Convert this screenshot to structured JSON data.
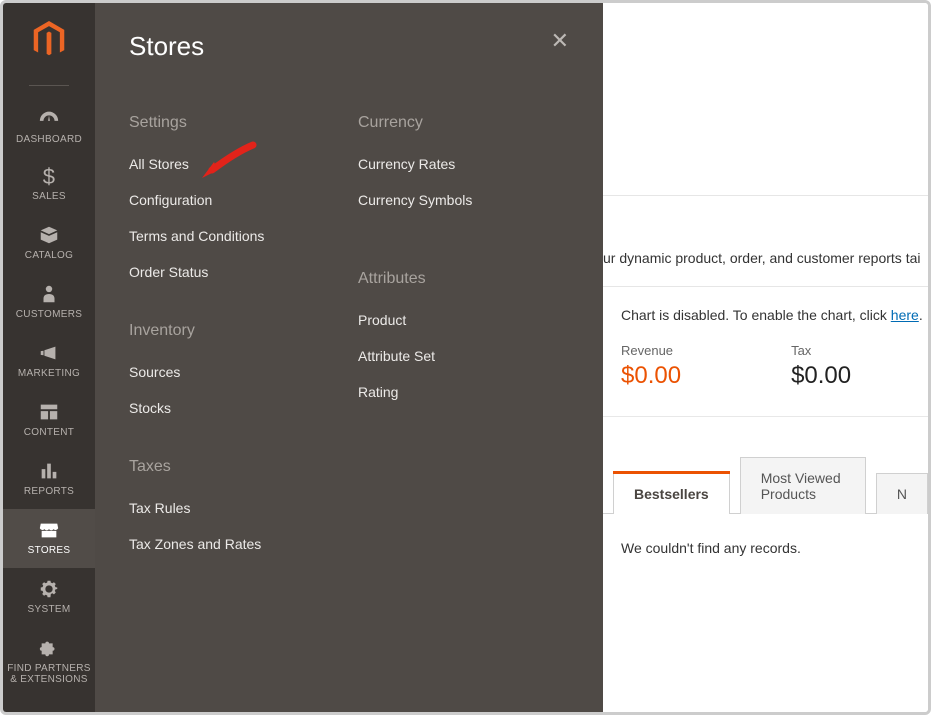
{
  "nav": {
    "items": [
      {
        "id": "dashboard",
        "label": "DASHBOARD"
      },
      {
        "id": "sales",
        "label": "SALES"
      },
      {
        "id": "catalog",
        "label": "CATALOG"
      },
      {
        "id": "customers",
        "label": "CUSTOMERS"
      },
      {
        "id": "marketing",
        "label": "MARKETING"
      },
      {
        "id": "content",
        "label": "CONTENT"
      },
      {
        "id": "reports",
        "label": "REPORTS"
      },
      {
        "id": "stores",
        "label": "STORES"
      },
      {
        "id": "system",
        "label": "SYSTEM"
      },
      {
        "id": "partners",
        "label": "FIND PARTNERS & EXTENSIONS"
      }
    ]
  },
  "flyout": {
    "title": "Stores",
    "column1": {
      "settings": {
        "title": "Settings",
        "items": [
          "All Stores",
          "Configuration",
          "Terms and Conditions",
          "Order Status"
        ]
      },
      "inventory": {
        "title": "Inventory",
        "items": [
          "Sources",
          "Stocks"
        ]
      },
      "taxes": {
        "title": "Taxes",
        "items": [
          "Tax Rules",
          "Tax Zones and Rates"
        ]
      }
    },
    "column2": {
      "currency": {
        "title": "Currency",
        "items": [
          "Currency Rates",
          "Currency Symbols"
        ]
      },
      "attributes": {
        "title": "Attributes",
        "items": [
          "Product",
          "Attribute Set",
          "Rating"
        ]
      }
    }
  },
  "main": {
    "bi_notice_fragment": "ur dynamic product, order, and customer reports tai",
    "chart_note_prefix": "Chart is disabled. To enable the chart, click ",
    "chart_note_link": "here",
    "stats": {
      "revenue": {
        "label": "Revenue",
        "value": "$0.00"
      },
      "tax": {
        "label": "Tax",
        "value": "$0.00"
      }
    },
    "tabs": {
      "bestsellers": "Bestsellers",
      "most_viewed": "Most Viewed Products",
      "new_frag": "N"
    },
    "no_records": "We couldn't find any records."
  }
}
